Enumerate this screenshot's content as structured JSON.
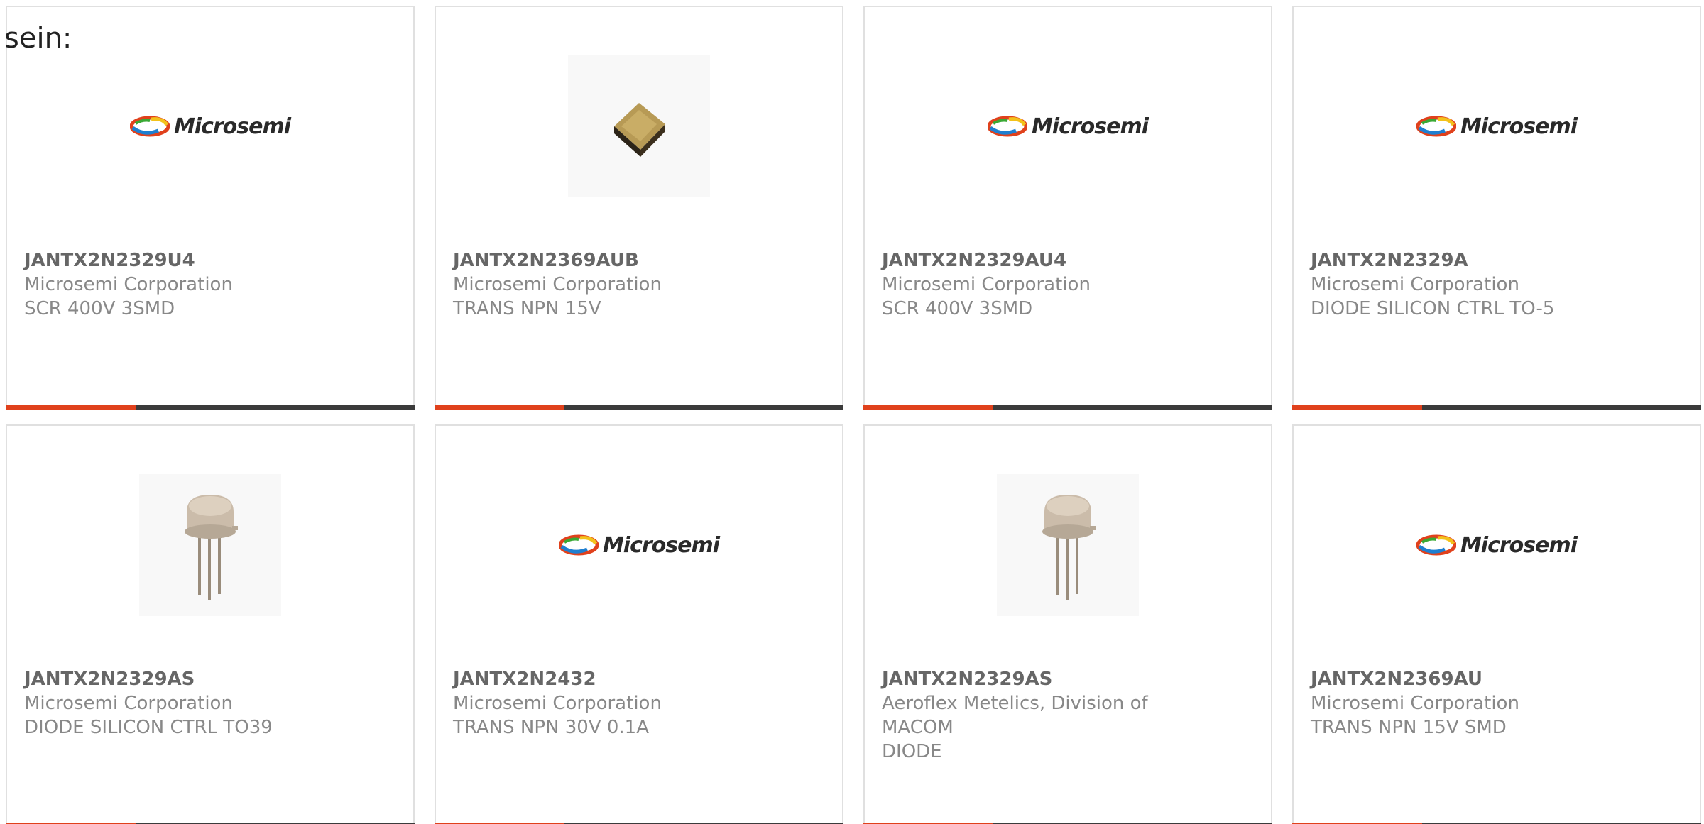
{
  "intro": "sein:",
  "colors": {
    "accent": "#e0411c",
    "bar": "#3b3b3b",
    "text": "#888888",
    "part_number": "#666666"
  },
  "products": [
    {
      "part": "JANTX2N2329U4",
      "maker": "Microsemi Corporation",
      "desc": "SCR 400V 3SMD",
      "image": "microsemi-logo"
    },
    {
      "part": "JANTX2N2369AUB",
      "maker": "Microsemi Corporation",
      "desc": "TRANS NPN 15V",
      "image": "smd-package-photo"
    },
    {
      "part": "JANTX2N2329AU4",
      "maker": "Microsemi Corporation",
      "desc": "SCR 400V 3SMD",
      "image": "microsemi-logo"
    },
    {
      "part": "JANTX2N2329A",
      "maker": "Microsemi Corporation",
      "desc": "DIODE SILICON CTRL TO-5",
      "image": "microsemi-logo"
    },
    {
      "part": "JANTX2N2329AS",
      "maker": "Microsemi Corporation",
      "desc": "DIODE SILICON CTRL TO39",
      "image": "to-can-photo"
    },
    {
      "part": "JANTX2N2432",
      "maker": "Microsemi Corporation",
      "desc": "TRANS NPN 30V 0.1A",
      "image": "microsemi-logo"
    },
    {
      "part": "JANTX2N2329AS",
      "maker": "Aeroflex Metelics, Division of MACOM",
      "desc": "DIODE",
      "image": "to-can-photo"
    },
    {
      "part": "JANTX2N2369AU",
      "maker": "Microsemi Corporation",
      "desc": "TRANS NPN 15V SMD",
      "image": "microsemi-logo"
    }
  ],
  "logo_text": "Microsemi"
}
